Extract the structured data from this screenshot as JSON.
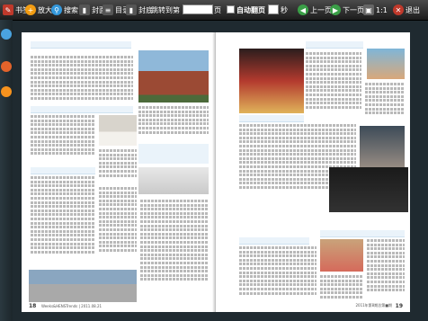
{
  "toolbar": {
    "bookmark_label": "书签",
    "zoom_in_label": "放大",
    "search_label": "搜索",
    "cover_label": "封面",
    "toc_label": "目录",
    "back_cover_label": "封底",
    "jump_label": "跳转到第",
    "page_input_value": "",
    "page_unit": "页",
    "seconds_unit": "秒",
    "auto_flip_label": "自动翻页",
    "seconds_input_value": "",
    "prev_label": "上一页",
    "next_label": "下一页",
    "ratio_label": "1:1",
    "exit_label": "退出"
  },
  "left_page": {
    "page_number": "18",
    "footer": "Weeks&HENSTrends | 2011.08.21"
  },
  "right_page": {
    "page_number": "19",
    "footer": "2011年第8期总第■期"
  },
  "colors": {
    "accent": "#f7931e",
    "link": "#1a73b5"
  }
}
